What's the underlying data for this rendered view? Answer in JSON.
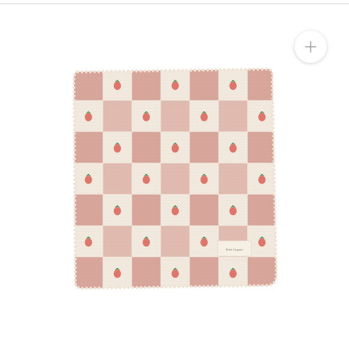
{
  "product_gallery": {
    "image": {
      "subject": "strawberry gingham muslin blanket",
      "label_text": "Bebe Organic"
    },
    "zoom_button": {
      "icon": "plus-icon",
      "aria_label": "Zoom"
    },
    "colors": {
      "pink_square": "#d9a79c",
      "cream_square": "#f4ece0",
      "strawberry": "#e0776c",
      "leaf": "#3a8a4c",
      "plus_stroke": "#9a9a9a"
    }
  }
}
